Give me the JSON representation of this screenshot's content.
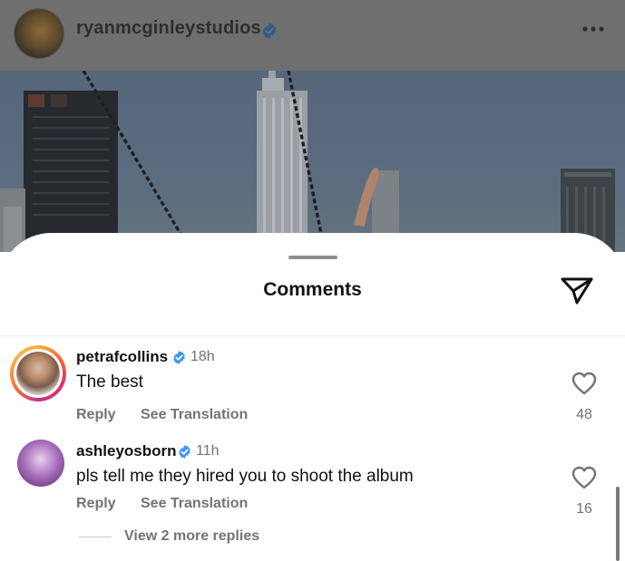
{
  "post": {
    "username": "ryanmcginleystudios",
    "verified": true,
    "icons": {
      "more": "more-dots-icon",
      "verified": "verified-badge-icon"
    }
  },
  "sheet": {
    "title": "Comments",
    "icons": {
      "share": "paper-plane-icon"
    }
  },
  "comments": [
    {
      "username": "petrafcollins",
      "verified": true,
      "time": "18h",
      "text": "The best",
      "reply_label": "Reply",
      "translate_label": "See Translation",
      "likes": "48",
      "has_story": true
    },
    {
      "username": "ashleyosborn",
      "verified": true,
      "time": "11h",
      "text": "pls tell me they hired you to shoot the album",
      "reply_label": "Reply",
      "translate_label": "See Translation",
      "likes": "16",
      "has_story": false
    }
  ],
  "view_replies_label": "View 2 more replies",
  "colors": {
    "verified_blue": "#3897f0",
    "secondary_text": "#737373",
    "overlay": "#6f6f6f"
  }
}
